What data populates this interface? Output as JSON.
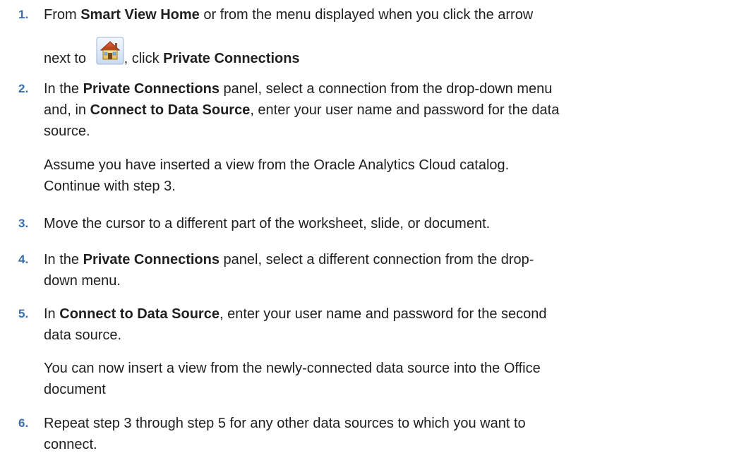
{
  "steps": [
    {
      "num": "1.",
      "a": "From ",
      "b1": "Smart View Home",
      "c": " or from the menu displayed when you click the arrow",
      "d": "next to",
      "icon": "home-icon",
      "e": ", click ",
      "b2": "Private Connections"
    },
    {
      "num": "2.",
      "a": "In the ",
      "b1": "Private Connections",
      "c": " panel, select a connection from the drop-down menu",
      "d": "and, in ",
      "b2": "Connect to Data Source",
      "e": ", enter your user name and password for the data",
      "f": "source.",
      "note1": "Assume you have inserted a view from the Oracle Analytics Cloud catalog.",
      "note2": "Continue with step 3."
    },
    {
      "num": "3.",
      "text": "Move the cursor to a different part of the worksheet, slide, or document."
    },
    {
      "num": "4.",
      "a": "In the ",
      "b1": "Private Connections",
      "c": " panel, select a different connection from the drop-",
      "d": "down menu."
    },
    {
      "num": "5.",
      "a": "In ",
      "b1": "Connect to Data Source",
      "c": ", enter your user name and password for the second",
      "d": "data source.",
      "note1": "You can now insert a view from the newly-connected data source into the Office",
      "note2": "document"
    },
    {
      "num": "6.",
      "a": "Repeat step 3 through step 5 for any other data sources to which you want to",
      "b": "connect."
    }
  ]
}
